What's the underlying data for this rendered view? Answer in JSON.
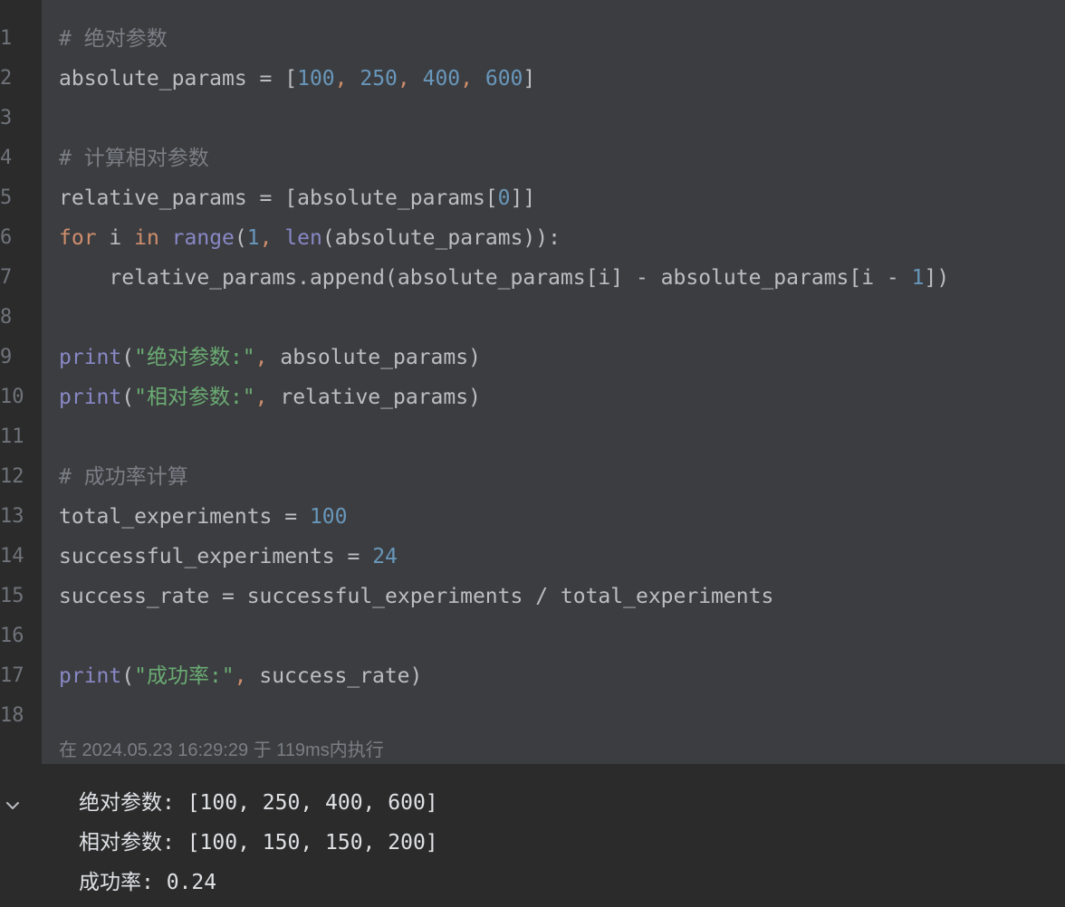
{
  "editor": {
    "line_numbers": [
      "1",
      "2",
      "3",
      "4",
      "5",
      "6",
      "7",
      "8",
      "9",
      "10",
      "11",
      "12",
      "13",
      "14",
      "15",
      "16",
      "17",
      "18"
    ],
    "lines": [
      [
        {
          "t": "# 绝对参数",
          "c": "comment"
        }
      ],
      [
        {
          "t": "absolute_params = [",
          "c": "plain"
        },
        {
          "t": "100",
          "c": "num"
        },
        {
          "t": ", ",
          "c": "punct"
        },
        {
          "t": "250",
          "c": "num"
        },
        {
          "t": ", ",
          "c": "punct"
        },
        {
          "t": "400",
          "c": "num"
        },
        {
          "t": ", ",
          "c": "punct"
        },
        {
          "t": "600",
          "c": "num"
        },
        {
          "t": "]",
          "c": "plain"
        }
      ],
      [],
      [
        {
          "t": "# 计算相对参数",
          "c": "comment"
        }
      ],
      [
        {
          "t": "relative_params = [absolute_params[",
          "c": "plain"
        },
        {
          "t": "0",
          "c": "num"
        },
        {
          "t": "]]",
          "c": "plain"
        }
      ],
      [
        {
          "t": "for",
          "c": "kw"
        },
        {
          "t": " i ",
          "c": "plain"
        },
        {
          "t": "in",
          "c": "kw"
        },
        {
          "t": " ",
          "c": "plain"
        },
        {
          "t": "range",
          "c": "builtin"
        },
        {
          "t": "(",
          "c": "plain"
        },
        {
          "t": "1",
          "c": "num"
        },
        {
          "t": ", ",
          "c": "punct"
        },
        {
          "t": "len",
          "c": "builtin"
        },
        {
          "t": "(absolute_params)):",
          "c": "plain"
        }
      ],
      [
        {
          "t": "    relative_params.append(absolute_params[i] - absolute_params[i - ",
          "c": "plain"
        },
        {
          "t": "1",
          "c": "num"
        },
        {
          "t": "])",
          "c": "plain"
        }
      ],
      [],
      [
        {
          "t": "print",
          "c": "builtin"
        },
        {
          "t": "(",
          "c": "plain"
        },
        {
          "t": "\"绝对参数:\"",
          "c": "str"
        },
        {
          "t": ", ",
          "c": "punct"
        },
        {
          "t": "absolute_params)",
          "c": "plain"
        }
      ],
      [
        {
          "t": "print",
          "c": "builtin"
        },
        {
          "t": "(",
          "c": "plain"
        },
        {
          "t": "\"相对参数:\"",
          "c": "str"
        },
        {
          "t": ", ",
          "c": "punct"
        },
        {
          "t": "relative_params)",
          "c": "plain"
        }
      ],
      [],
      [
        {
          "t": "# 成功率计算",
          "c": "comment"
        }
      ],
      [
        {
          "t": "total_experiments = ",
          "c": "plain"
        },
        {
          "t": "100",
          "c": "num"
        }
      ],
      [
        {
          "t": "successful_experiments = ",
          "c": "plain"
        },
        {
          "t": "24",
          "c": "num"
        }
      ],
      [
        {
          "t": "success_rate = successful_experiments / total_experiments",
          "c": "plain"
        }
      ],
      [],
      [
        {
          "t": "print",
          "c": "builtin"
        },
        {
          "t": "(",
          "c": "plain"
        },
        {
          "t": "\"成功率:\"",
          "c": "str"
        },
        {
          "t": ", ",
          "c": "punct"
        },
        {
          "t": "success_rate)",
          "c": "plain"
        }
      ],
      []
    ]
  },
  "execution": {
    "status_text": "在 2024.05.23 16:29:29 于 119ms内执行"
  },
  "output": {
    "lines": [
      "绝对参数: [100, 250, 400, 600]",
      "相对参数: [100, 150, 150, 200]",
      "成功率: 0.24"
    ],
    "collapse_icon": "chevron-down-icon"
  },
  "colors": {
    "editor_bg": "#3c3d40",
    "gutter_bg": "#2b2b2b",
    "comment": "#7a7e85",
    "number": "#6897bb",
    "keyword": "#cf8e6d",
    "builtin": "#8888c6",
    "string": "#6aab73",
    "text": "#bcbec4"
  }
}
